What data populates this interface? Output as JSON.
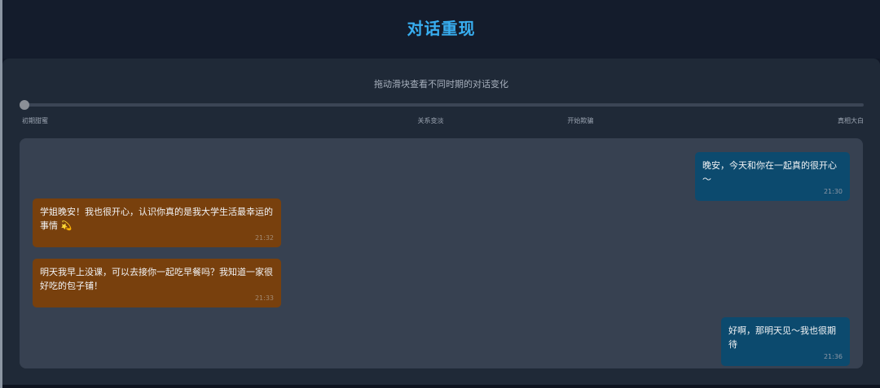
{
  "header": {
    "title": "对话重现"
  },
  "timeline": {
    "hint": "拖动滑块查看不同时期的对话变化",
    "position": 0,
    "stages": [
      "初期甜蜜",
      "关系变淡",
      "开始欺骗",
      "真相大白"
    ]
  },
  "messages": [
    {
      "sender": "me",
      "text": "晚安，今天和你在一起真的很开心～",
      "time": "21:30"
    },
    {
      "sender": "other",
      "text": "学姐晚安！我也很开心，认识你真的是我大学生活最幸运的事情 💫",
      "time": "21:32"
    },
    {
      "sender": "other",
      "text": "明天我早上没课，可以去接你一起吃早餐吗？我知道一家很好吃的包子铺！",
      "time": "21:33"
    },
    {
      "sender": "me",
      "text": "好啊，那明天见～我也很期待",
      "time": "21:36"
    }
  ],
  "colors": {
    "title": "#38aef0",
    "me_bubble": "#0c4a6e",
    "other_bubble": "#78400d",
    "panel": "#1f2937",
    "chat_bg": "#374151"
  }
}
